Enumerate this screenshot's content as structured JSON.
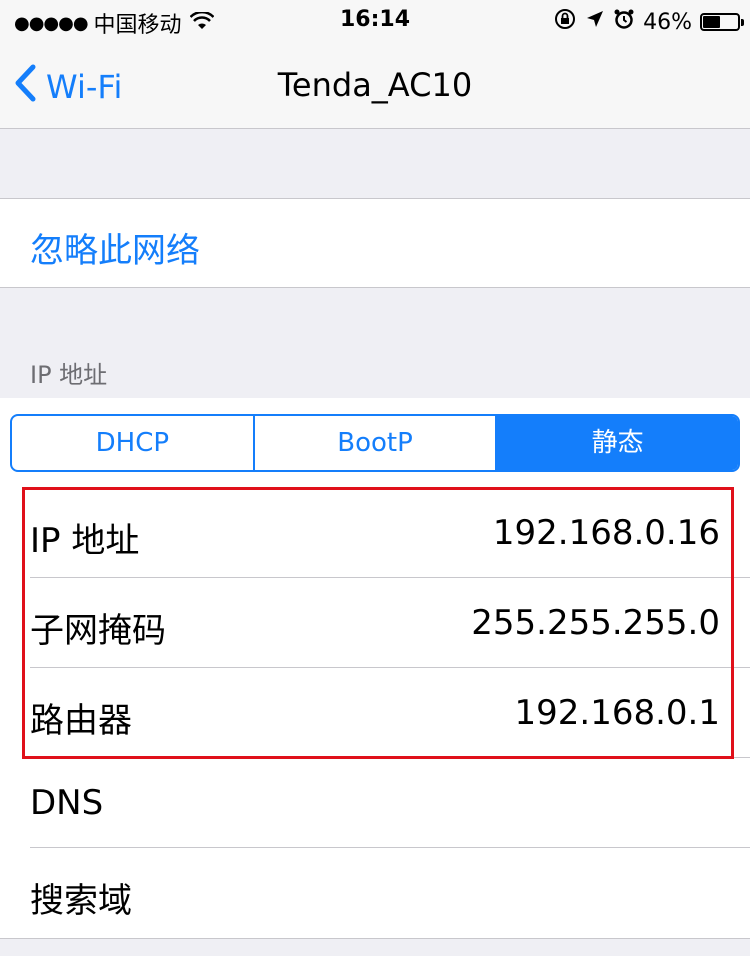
{
  "status_bar": {
    "carrier": "中国移动",
    "time": "16:14",
    "battery_percent": "46%",
    "battery_level": 0.46,
    "icons": [
      "signal-dots-icon",
      "wifi-icon",
      "rotation-lock-icon",
      "location-arrow-icon",
      "alarm-icon",
      "battery-icon"
    ]
  },
  "nav": {
    "back_label": "Wi-Fi",
    "title": "Tenda_AC10"
  },
  "forget": {
    "label": "忽略此网络"
  },
  "ip_section": {
    "header": "IP 地址",
    "segments": [
      "DHCP",
      "BootP",
      "静态"
    ],
    "selected_segment": "静态"
  },
  "rows": [
    {
      "label": "IP 地址",
      "value": "192.168.0.16"
    },
    {
      "label": "子网掩码",
      "value": "255.255.255.0"
    },
    {
      "label": "路由器",
      "value": "192.168.0.1"
    },
    {
      "label": "DNS",
      "value": ""
    },
    {
      "label": "搜索域",
      "value": ""
    }
  ],
  "colors": {
    "accent": "#147efb",
    "highlight": "#e0101a",
    "background": "#efeff4"
  }
}
